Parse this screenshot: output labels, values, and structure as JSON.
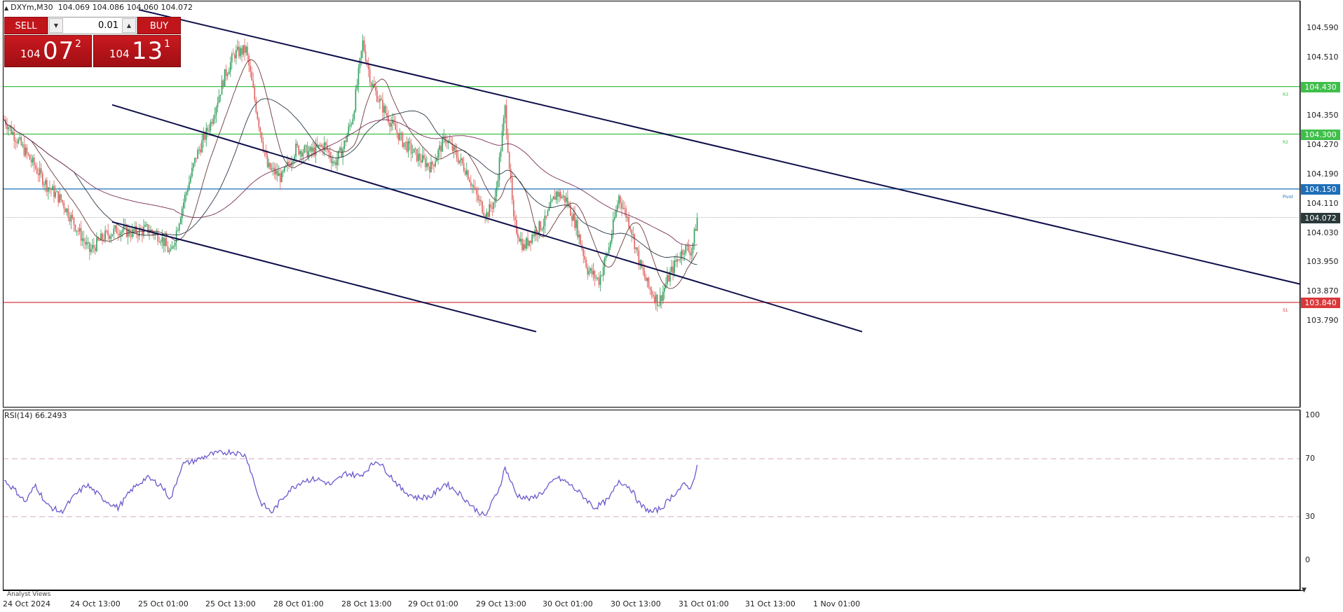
{
  "header": {
    "symbol": "DXYm,M30",
    "ohlc": "104.069 104.086 104.060 104.072"
  },
  "trade_panel": {
    "sell_label": "SELL",
    "buy_label": "BUY",
    "lot_value": "0.01",
    "sell_quote": {
      "prefix": "104",
      "big": "07",
      "sup": "2"
    },
    "buy_quote": {
      "prefix": "104",
      "big": "13",
      "sup": "1"
    }
  },
  "price_axis": {
    "labels": [
      "104.590",
      "104.510",
      "104.350",
      "104.270",
      "104.190",
      "104.110",
      "104.030",
      "103.950",
      "103.870",
      "103.790"
    ]
  },
  "levels": [
    {
      "price": 104.43,
      "label": "104.430",
      "tag": "R3",
      "color": "#3fbf4a"
    },
    {
      "price": 104.3,
      "label": "104.300",
      "tag": "R2",
      "color": "#3fbf4a"
    },
    {
      "price": 104.15,
      "label": "104.150",
      "tag": "Pivot",
      "color": "#1e6fb8"
    },
    {
      "price": 103.84,
      "label": "103.840",
      "tag": "S1",
      "color": "#d9383a"
    }
  ],
  "current_price": {
    "price": 104.072,
    "label": "104.072",
    "color": "#2a3a3a"
  },
  "time_axis": {
    "labels": [
      "24 Oct 2024",
      "24 Oct 13:00",
      "25 Oct 01:00",
      "25 Oct 13:00",
      "28 Oct 01:00",
      "28 Oct 13:00",
      "29 Oct 01:00",
      "29 Oct 13:00",
      "30 Oct 01:00",
      "30 Oct 13:00",
      "31 Oct 01:00",
      "31 Oct 13:00",
      "1 Nov 01:00"
    ]
  },
  "rsi": {
    "title": "RSI(14) 66.2493",
    "levels": [
      "100",
      "70",
      "30",
      "0"
    ],
    "upper": 70,
    "lower": 30,
    "line_color": "#6a5acd"
  },
  "footer": {
    "analyst_views": "Analyst Views"
  },
  "colors": {
    "bull": "#2e9e5b",
    "bear": "#e0625e",
    "channel": "#0e0e4a",
    "ma_fast": "#6b3a3a",
    "ma_mid": "#2c3a4a",
    "ma_slow": "#7b2e57"
  },
  "chart_data": {
    "type": "candlestick",
    "instrument": "DXYm",
    "timeframe": "M30",
    "ylim": [
      103.76,
      104.64
    ],
    "candle_count": 240,
    "close_anchors": [
      [
        0,
        104.34
      ],
      [
        10,
        104.28
      ],
      [
        20,
        104.22
      ],
      [
        30,
        104.16
      ],
      [
        40,
        104.12
      ],
      [
        50,
        104.05
      ],
      [
        60,
        103.98
      ],
      [
        70,
        104.02
      ],
      [
        80,
        104.04
      ],
      [
        90,
        104.03
      ],
      [
        100,
        104.04
      ],
      [
        110,
        104.02
      ],
      [
        117,
        103.97
      ],
      [
        125,
        104.1
      ],
      [
        135,
        104.24
      ],
      [
        145,
        104.33
      ],
      [
        155,
        104.46
      ],
      [
        162,
        104.52
      ],
      [
        170,
        104.53
      ],
      [
        178,
        104.35
      ],
      [
        185,
        104.21
      ],
      [
        195,
        104.18
      ],
      [
        205,
        104.26
      ],
      [
        215,
        104.25
      ],
      [
        225,
        104.27
      ],
      [
        232,
        104.22
      ],
      [
        238,
        104.26
      ],
      [
        245,
        104.35
      ],
      [
        252,
        104.55
      ],
      [
        258,
        104.44
      ],
      [
        265,
        104.38
      ],
      [
        272,
        104.33
      ],
      [
        280,
        104.28
      ],
      [
        290,
        104.24
      ],
      [
        300,
        104.21
      ],
      [
        310,
        104.29
      ],
      [
        318,
        104.24
      ],
      [
        325,
        104.2
      ],
      [
        333,
        104.12
      ],
      [
        339,
        104.08
      ],
      [
        345,
        104.12
      ],
      [
        352,
        104.37
      ],
      [
        358,
        104.06
      ],
      [
        365,
        103.99
      ],
      [
        372,
        104.03
      ],
      [
        380,
        104.06
      ],
      [
        388,
        104.14
      ],
      [
        395,
        104.12
      ],
      [
        402,
        104.05
      ],
      [
        410,
        103.93
      ],
      [
        418,
        103.9
      ],
      [
        425,
        103.99
      ],
      [
        432,
        104.13
      ],
      [
        440,
        104.05
      ],
      [
        447,
        103.94
      ],
      [
        453,
        103.88
      ],
      [
        460,
        103.84
      ],
      [
        466,
        103.9
      ],
      [
        472,
        103.95
      ],
      [
        478,
        103.99
      ],
      [
        483,
        103.98
      ],
      [
        487,
        104.07
      ]
    ],
    "rsi_anchors": [
      [
        0,
        55
      ],
      [
        8,
        48
      ],
      [
        15,
        40
      ],
      [
        22,
        52
      ],
      [
        30,
        38
      ],
      [
        40,
        33
      ],
      [
        50,
        45
      ],
      [
        58,
        52
      ],
      [
        70,
        42
      ],
      [
        80,
        36
      ],
      [
        90,
        49
      ],
      [
        100,
        57
      ],
      [
        110,
        52
      ],
      [
        117,
        42
      ],
      [
        125,
        66
      ],
      [
        135,
        69
      ],
      [
        145,
        73
      ],
      [
        160,
        75
      ],
      [
        170,
        72
      ],
      [
        180,
        40
      ],
      [
        188,
        33
      ],
      [
        200,
        48
      ],
      [
        210,
        55
      ],
      [
        220,
        56
      ],
      [
        230,
        52
      ],
      [
        240,
        60
      ],
      [
        250,
        58
      ],
      [
        262,
        69
      ],
      [
        270,
        60
      ],
      [
        280,
        48
      ],
      [
        290,
        43
      ],
      [
        300,
        44
      ],
      [
        310,
        53
      ],
      [
        320,
        46
      ],
      [
        330,
        36
      ],
      [
        338,
        30
      ],
      [
        348,
        50
      ],
      [
        352,
        64
      ],
      [
        360,
        45
      ],
      [
        370,
        42
      ],
      [
        380,
        48
      ],
      [
        388,
        57
      ],
      [
        395,
        54
      ],
      [
        405,
        46
      ],
      [
        415,
        36
      ],
      [
        425,
        42
      ],
      [
        432,
        55
      ],
      [
        440,
        50
      ],
      [
        447,
        38
      ],
      [
        455,
        33
      ],
      [
        462,
        36
      ],
      [
        470,
        45
      ],
      [
        478,
        52
      ],
      [
        483,
        50
      ],
      [
        487,
        66
      ]
    ],
    "channel_lines": [
      {
        "from": [
          104.64,
          198
        ],
        "to": [
          103.89,
          1855
        ]
      },
      {
        "from": [
          104.38,
          160
        ],
        "to": [
          103.76,
          1230
        ]
      },
      {
        "from": [
          104.06,
          160
        ],
        "to": [
          103.76,
          765
        ]
      }
    ]
  }
}
